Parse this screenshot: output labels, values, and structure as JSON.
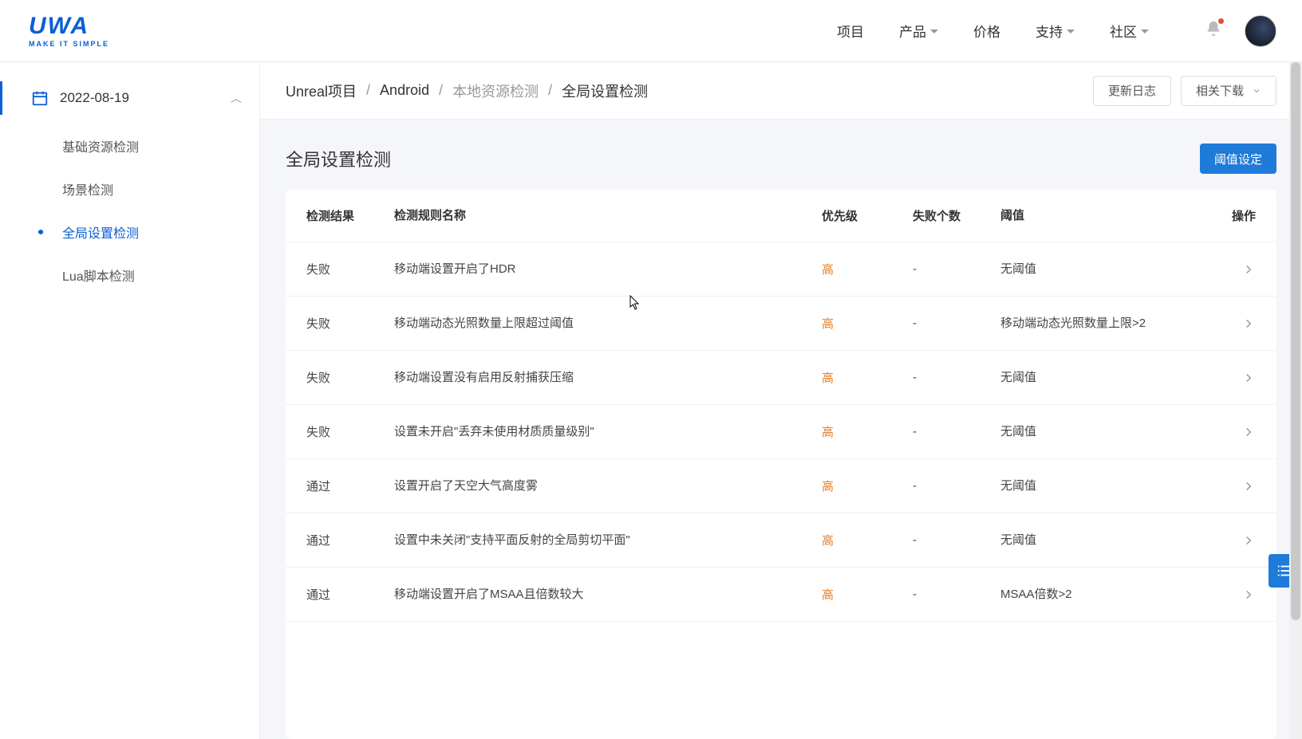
{
  "logo": {
    "main": "UWA",
    "sub": "MAKE IT SIMPLE"
  },
  "nav": {
    "items": [
      {
        "label": "项目",
        "caret": false
      },
      {
        "label": "产品",
        "caret": true
      },
      {
        "label": "价格",
        "caret": false
      },
      {
        "label": "支持",
        "caret": true
      },
      {
        "label": "社区",
        "caret": true
      }
    ]
  },
  "sidebar": {
    "date": "2022-08-19",
    "items": [
      {
        "label": "基础资源检测",
        "active": false
      },
      {
        "label": "场景检测",
        "active": false
      },
      {
        "label": "全局设置检测",
        "active": true
      },
      {
        "label": "Lua脚本检测",
        "active": false
      }
    ]
  },
  "breadcrumb": {
    "parts": [
      "Unreal项目",
      "Android",
      "本地资源检测",
      "全局设置检测"
    ],
    "update_log": "更新日志",
    "download": "相关下载"
  },
  "section": {
    "title": "全局设置检测",
    "threshold_btn": "阈值设定"
  },
  "table": {
    "headers": {
      "result": "检测结果",
      "rule": "检测规则名称",
      "priority": "优先级",
      "fail_count": "失败个数",
      "threshold": "阈值",
      "operation": "操作"
    },
    "rows": [
      {
        "result": "失败",
        "rule": "移动端设置开启了HDR",
        "priority": "高",
        "fail_count": "-",
        "threshold": "无阈值"
      },
      {
        "result": "失败",
        "rule": "移动端动态光照数量上限超过阈值",
        "priority": "高",
        "fail_count": "-",
        "threshold": "移动端动态光照数量上限>2"
      },
      {
        "result": "失败",
        "rule": "移动端设置没有启用反射捕获压缩",
        "priority": "高",
        "fail_count": "-",
        "threshold": "无阈值"
      },
      {
        "result": "失败",
        "rule": "设置未开启\"丢弃未使用材质质量级别\"",
        "priority": "高",
        "fail_count": "-",
        "threshold": "无阈值"
      },
      {
        "result": "通过",
        "rule": "设置开启了天空大气高度雾",
        "priority": "高",
        "fail_count": "-",
        "threshold": "无阈值"
      },
      {
        "result": "通过",
        "rule": "设置中未关闭\"支持平面反射的全局剪切平面\"",
        "priority": "高",
        "fail_count": "-",
        "threshold": "无阈值"
      },
      {
        "result": "通过",
        "rule": "移动端设置开启了MSAA且倍数较大",
        "priority": "高",
        "fail_count": "-",
        "threshold": "MSAA倍数>2"
      }
    ]
  }
}
